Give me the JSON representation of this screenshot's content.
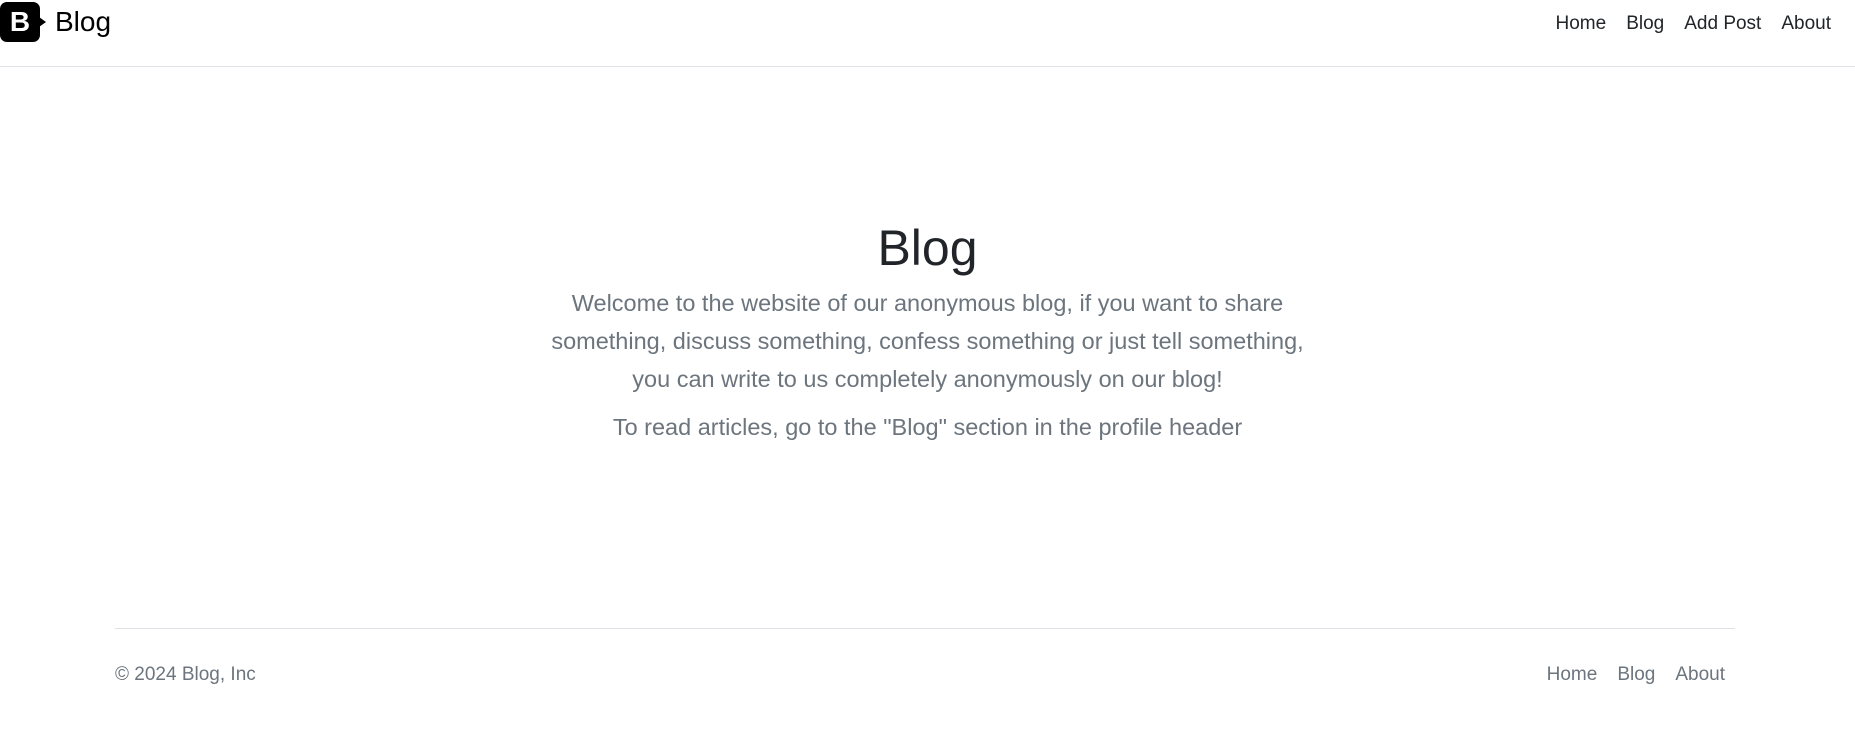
{
  "header": {
    "brand_logo_letter": "B",
    "brand_name": "Blog",
    "nav": [
      {
        "label": "Home"
      },
      {
        "label": "Blog"
      },
      {
        "label": "Add Post"
      },
      {
        "label": "About"
      }
    ]
  },
  "hero": {
    "title": "Blog",
    "lead": "Welcome to the website of our anonymous blog, if you want to share something, discuss something, confess something or just tell something, you can write to us completely anonymously on our blog!",
    "lead2": "To read articles, go to the \"Blog\" section in the profile header"
  },
  "footer": {
    "copyright": "© 2024 Blog, Inc",
    "nav": [
      {
        "label": "Home"
      },
      {
        "label": "Blog"
      },
      {
        "label": "About"
      }
    ]
  },
  "colors": {
    "text": "#212529",
    "muted": "#6c757d",
    "border": "#dee2e6",
    "logo_bg": "#000000"
  },
  "icons": {
    "brand_logo": "bootstrap-logo-icon"
  }
}
